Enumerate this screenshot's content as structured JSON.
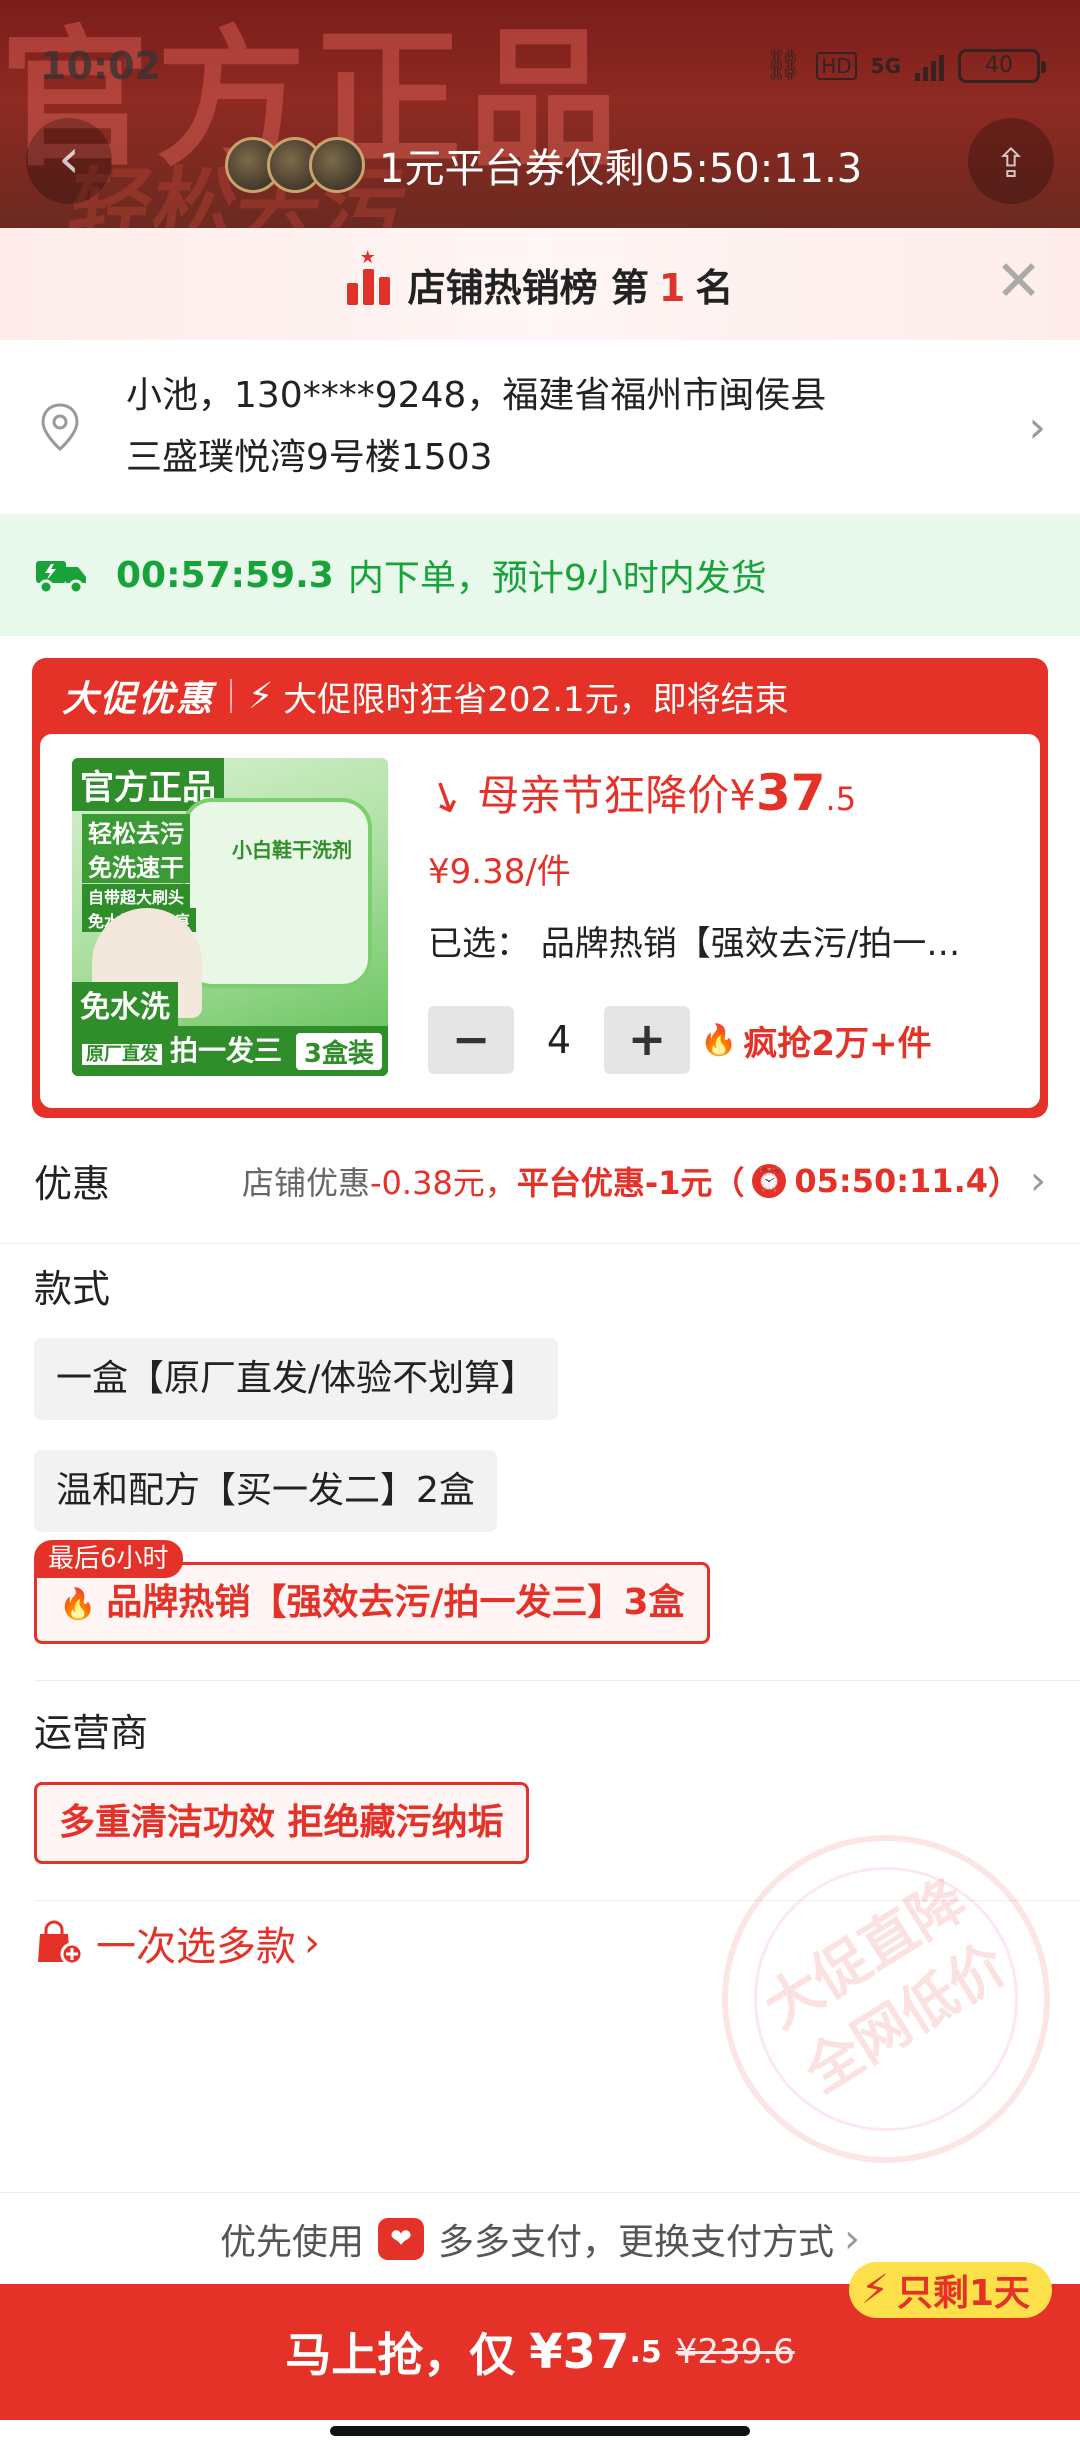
{
  "status": {
    "time": "10:02",
    "signal_label": "5G",
    "hd_label": "HD",
    "battery": "40"
  },
  "banner": {
    "bg_text_1": "官方正品",
    "bg_text_2": "轻松去污",
    "coupon_text": "1元平台券仅剩05:50:11.3"
  },
  "rank": {
    "prefix": "店铺热销榜 第",
    "number": "1",
    "suffix": "名"
  },
  "address": {
    "line1": "小池，130****9248，福建省福州市闽侯县",
    "line2": "三盛璞悦湾9号楼1503"
  },
  "shipping": {
    "countdown": "00:57:59.3",
    "message": "内下单，预计9小时内发货"
  },
  "promo": {
    "tag": "大促优惠",
    "message": "大促限时狂省202.1元，即将结束",
    "price_label": "母亲节狂降价¥",
    "price_int": "37",
    "price_dec": ".5",
    "unit_price": "¥9.38/件",
    "selected": "已选：  品牌热销【强效去污/拍一…",
    "quantity": "4",
    "hot_text": "疯抢2万+件",
    "image_texts": {
      "ribbon": "官方正品",
      "l1": "轻松去污",
      "l2": "免洗速干",
      "l3": "自带超大刷头",
      "l4": "免水洗 不留痕",
      "left_badge": "免水洗",
      "factory": "原厂直发",
      "bottom": "拍一发三",
      "bottom2": "3盒装",
      "box": "小白鞋干洗剂"
    }
  },
  "discount": {
    "title": "优惠",
    "shop_label": "店铺优惠",
    "shop_value": "-0.38元，",
    "platform_label": "平台优惠-1元（",
    "timer": "05:50:11.4",
    "close_paren": "）"
  },
  "style": {
    "title": "款式",
    "options": [
      "一盒【原厂直发/体验不划算】",
      "温和配方【买一发二】2盒",
      "品牌热销【强效去污/拍一发三】3盒"
    ],
    "badge": "最后6小时"
  },
  "operator": {
    "title": "运营商",
    "option": "多重清洁功效 拒绝藏污纳垢"
  },
  "multi_select": "一次选多款",
  "stamp": {
    "line1": "大促直降",
    "line2": "全网低价"
  },
  "payment": {
    "prefix": "优先使用",
    "name": "多多支付，更换支付方式"
  },
  "buy": {
    "label": "马上抢，仅",
    "price_int": "¥37",
    "price_dec": ".5",
    "original": "¥239.6",
    "last_day": "只剩1天"
  },
  "colors": {
    "accent": "#e53228",
    "green": "#18a33a",
    "banner": "#8e2a22"
  }
}
